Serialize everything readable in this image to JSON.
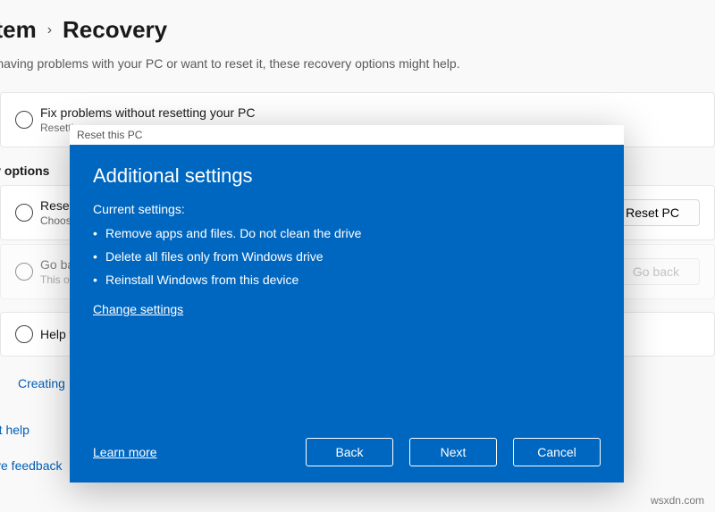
{
  "breadcrumb": {
    "parent_fragment": "stem",
    "current": "Recovery"
  },
  "subtext_fragment": "re having problems with your PC or want to reset it, these recovery options might help.",
  "card_fix": {
    "title": "Fix problems without resetting your PC",
    "desc_fragment": "Resetting"
  },
  "section_label_fragment": "ery options",
  "card_reset": {
    "title_fragment": "Reset th",
    "desc_fragment": "Choose to",
    "action": "Reset PC"
  },
  "card_goback": {
    "title_fragment": "Go back",
    "desc_fragment": "This optio",
    "action": "Go back"
  },
  "card_help": {
    "title_fragment": "Help wit"
  },
  "links": {
    "creating": "Creating",
    "get_help": "Get help",
    "give_feedback": "Give feedback"
  },
  "dialog": {
    "window_title": "Reset this PC",
    "heading": "Additional settings",
    "current_label": "Current settings:",
    "bullets": [
      "Remove apps and files. Do not clean the drive",
      "Delete all files only from Windows drive",
      "Reinstall Windows from this device"
    ],
    "change_settings": "Change settings",
    "learn_more": "Learn more",
    "back": "Back",
    "next": "Next",
    "cancel": "Cancel"
  },
  "watermark": "wsxdn.com"
}
